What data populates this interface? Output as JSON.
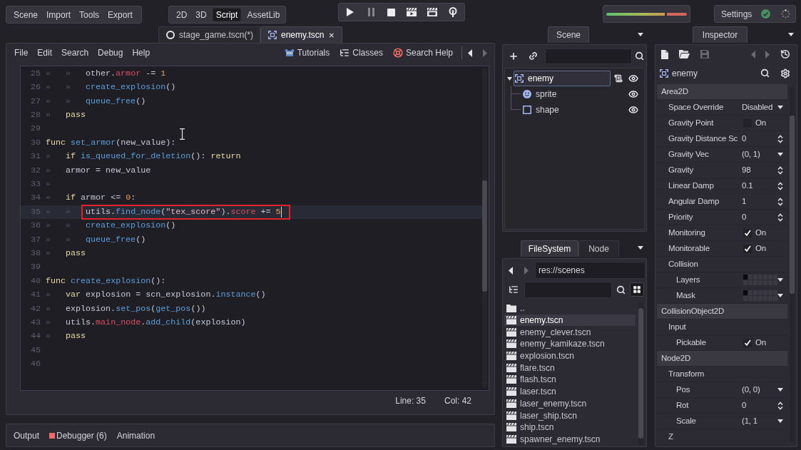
{
  "top_menu": [
    "Scene",
    "Import",
    "Tools",
    "Export"
  ],
  "main_screens": [
    {
      "label": "2D",
      "selected": false
    },
    {
      "label": "3D",
      "selected": false
    },
    {
      "label": "Script",
      "selected": true
    },
    {
      "label": "AssetLib",
      "selected": false
    }
  ],
  "play_controls": [
    {
      "kind": "play",
      "disabled": false
    },
    {
      "kind": "pause",
      "disabled": true
    },
    {
      "kind": "stop",
      "disabled": false
    },
    {
      "kind": "play_scene",
      "disabled": false
    },
    {
      "kind": "play_custom",
      "disabled": false
    },
    {
      "kind": "remote",
      "disabled": false
    }
  ],
  "audio_meter": {
    "level": 1
  },
  "settings": {
    "label": "Settings"
  },
  "scene_tabs": [
    {
      "label": "stage_game.tscn(*)",
      "kind": "node",
      "selected": false
    },
    {
      "label": "enemy.tscn",
      "kind": "area2d",
      "selected": true
    }
  ],
  "script_editor": {
    "menu": [
      "File",
      "Edit",
      "Search",
      "Debug",
      "Help"
    ],
    "help_links": [
      {
        "kind": "tutorials",
        "label": "Tutorials"
      },
      {
        "kind": "classes",
        "label": "Classes"
      },
      {
        "kind": "search_help",
        "label": "Search Help"
      }
    ],
    "nav": [
      {
        "kind": "back",
        "disabled": false
      },
      {
        "kind": "forward",
        "disabled": true
      }
    ],
    "lines": [
      {
        "number": "25",
        "indent": [
          "»",
          "»"
        ],
        "tokens": [
          {
            "kind": "plain",
            "text": "other."
          },
          {
            "kind": "member",
            "text": "armor"
          },
          {
            "kind": "plain",
            "text": " -= "
          },
          {
            "kind": "number",
            "text": "1"
          }
        ],
        "current": false,
        "boxed": false
      },
      {
        "number": "26",
        "indent": [
          "»",
          "»"
        ],
        "tokens": [
          {
            "kind": "function",
            "text": "create_explosion"
          },
          {
            "kind": "plain",
            "text": "()"
          }
        ],
        "current": false,
        "boxed": false
      },
      {
        "number": "27",
        "indent": [
          "»",
          "»"
        ],
        "tokens": [
          {
            "kind": "function",
            "text": "queue_free"
          },
          {
            "kind": "plain",
            "text": "()"
          }
        ],
        "current": false,
        "boxed": false
      },
      {
        "number": "28",
        "indent": [
          "»"
        ],
        "tokens": [
          {
            "kind": "keyword",
            "text": "pass"
          }
        ],
        "current": false,
        "boxed": false
      },
      {
        "number": "29",
        "current": false,
        "boxed": false
      },
      {
        "number": "30",
        "tokens": [
          {
            "kind": "keyword",
            "text": "func"
          },
          {
            "kind": "function",
            "text": " set_armor"
          },
          {
            "kind": "plain",
            "text": "(new_value):"
          }
        ],
        "current": false,
        "boxed": false
      },
      {
        "number": "31",
        "indent": [
          "»"
        ],
        "tokens": [
          {
            "kind": "keyword",
            "text": "if"
          },
          {
            "kind": "function",
            "text": " is_queued_for_deletion"
          },
          {
            "kind": "plain",
            "text": "(): "
          },
          {
            "kind": "keyword",
            "text": "return"
          }
        ],
        "current": false,
        "boxed": false
      },
      {
        "number": "32",
        "indent": [
          "»"
        ],
        "tokens": [
          {
            "kind": "plain",
            "text": "armor = new_value"
          }
        ],
        "current": false,
        "boxed": false
      },
      {
        "number": "33",
        "indent": [
          "»"
        ],
        "current": false,
        "boxed": false
      },
      {
        "number": "34",
        "indent": [
          "»"
        ],
        "tokens": [
          {
            "kind": "keyword",
            "text": "if"
          },
          {
            "kind": "plain",
            "text": " armor <= "
          },
          {
            "kind": "number",
            "text": "0"
          },
          {
            "kind": "plain",
            "text": ":"
          }
        ],
        "current": false,
        "boxed": false
      },
      {
        "number": "35",
        "indent": [
          "»",
          "»"
        ],
        "tokens": [
          {
            "kind": "plain",
            "text": "utils."
          },
          {
            "kind": "function",
            "text": "find_node"
          },
          {
            "kind": "plain",
            "text": "("
          },
          {
            "kind": "string",
            "text": "\"tex_score\""
          },
          {
            "kind": "plain",
            "text": ")."
          },
          {
            "kind": "member",
            "text": "score"
          },
          {
            "kind": "plain",
            "text": " += "
          },
          {
            "kind": "number",
            "text": "5"
          }
        ],
        "current": true,
        "boxed": true
      },
      {
        "number": "36",
        "indent": [
          "»",
          "»"
        ],
        "tokens": [
          {
            "kind": "function",
            "text": "create_explosion"
          },
          {
            "kind": "plain",
            "text": "()"
          }
        ],
        "current": false,
        "boxed": false
      },
      {
        "number": "37",
        "indent": [
          "»",
          "»"
        ],
        "tokens": [
          {
            "kind": "function",
            "text": "queue_free"
          },
          {
            "kind": "plain",
            "text": "()"
          }
        ],
        "current": false,
        "boxed": false
      },
      {
        "number": "38",
        "indent": [
          "»"
        ],
        "tokens": [
          {
            "kind": "keyword",
            "text": "pass"
          }
        ],
        "current": false,
        "boxed": false
      },
      {
        "number": "39",
        "current": false,
        "boxed": false
      },
      {
        "number": "40",
        "tokens": [
          {
            "kind": "keyword",
            "text": "func"
          },
          {
            "kind": "function",
            "text": " create_explosion"
          },
          {
            "kind": "plain",
            "text": "():"
          }
        ],
        "current": false,
        "boxed": false
      },
      {
        "number": "41",
        "indent": [
          "»"
        ],
        "tokens": [
          {
            "kind": "keyword",
            "text": "var"
          },
          {
            "kind": "plain",
            "text": " explosion = scn_explosion."
          },
          {
            "kind": "function",
            "text": "instance"
          },
          {
            "kind": "plain",
            "text": "()"
          }
        ],
        "current": false,
        "boxed": false
      },
      {
        "number": "42",
        "indent": [
          "»"
        ],
        "tokens": [
          {
            "kind": "plain",
            "text": "explosion."
          },
          {
            "kind": "function",
            "text": "set_pos"
          },
          {
            "kind": "plain",
            "text": "("
          },
          {
            "kind": "function",
            "text": "get_pos"
          },
          {
            "kind": "plain",
            "text": "())"
          }
        ],
        "current": false,
        "boxed": false
      },
      {
        "number": "43",
        "indent": [
          "»"
        ],
        "tokens": [
          {
            "kind": "plain",
            "text": "utils."
          },
          {
            "kind": "member",
            "text": "main_node"
          },
          {
            "kind": "plain",
            "text": "."
          },
          {
            "kind": "function",
            "text": "add_child"
          },
          {
            "kind": "plain",
            "text": "(explosion)"
          }
        ],
        "current": false,
        "boxed": false
      },
      {
        "number": "44",
        "indent": [
          "»"
        ],
        "tokens": [
          {
            "kind": "keyword",
            "text": "pass"
          }
        ],
        "current": false,
        "boxed": false
      },
      {
        "number": "45",
        "current": false,
        "boxed": false
      },
      {
        "number": "46",
        "current": false,
        "boxed": false
      }
    ],
    "status": {
      "line": "Line: 35",
      "column": "Col: 42"
    }
  },
  "bottom_tabs": [
    {
      "label": "Output",
      "alert": false
    },
    {
      "label": "Debugger (6)",
      "alert": true
    },
    {
      "label": "Animation",
      "alert": false
    }
  ],
  "scene_dock": {
    "tab": "Scene",
    "tree": [
      {
        "name": "enemy",
        "kind": "area2d",
        "selected": true,
        "expanded": true,
        "has_script": true,
        "visible": true,
        "children": [
          {
            "name": "sprite",
            "kind": "sprite",
            "selected": false,
            "has_script": false,
            "visible": true
          },
          {
            "name": "shape",
            "kind": "shape",
            "selected": false,
            "has_script": false,
            "visible": true
          }
        ]
      }
    ]
  },
  "filesystem_dock": {
    "tabs": [
      {
        "label": "FileSystem",
        "selected": true
      },
      {
        "label": "Node",
        "selected": false
      }
    ],
    "nav": [
      {
        "kind": "back",
        "disabled": false
      },
      {
        "kind": "forward",
        "disabled": true
      }
    ],
    "path": "res://scenes",
    "files": [
      {
        "name": "..",
        "kind": "folder",
        "selected": false
      },
      {
        "name": "enemy.tscn",
        "kind": "scene",
        "selected": true
      },
      {
        "name": "enemy_clever.tscn",
        "kind": "scene",
        "selected": false
      },
      {
        "name": "enemy_kamikaze.tscn",
        "kind": "scene",
        "selected": false
      },
      {
        "name": "explosion.tscn",
        "kind": "scene",
        "selected": false
      },
      {
        "name": "flare.tscn",
        "kind": "scene",
        "selected": false
      },
      {
        "name": "flash.tscn",
        "kind": "scene",
        "selected": false
      },
      {
        "name": "laser.tscn",
        "kind": "scene",
        "selected": false
      },
      {
        "name": "laser_enemy.tscn",
        "kind": "scene",
        "selected": false
      },
      {
        "name": "laser_ship.tscn",
        "kind": "scene",
        "selected": false
      },
      {
        "name": "ship.tscn",
        "kind": "scene",
        "selected": false
      },
      {
        "name": "spawner_enemy.tscn",
        "kind": "scene",
        "selected": false
      }
    ]
  },
  "inspector": {
    "tab": "Inspector",
    "toolbar": [
      {
        "kind": "new",
        "disabled": false
      },
      {
        "kind": "open",
        "disabled": false
      },
      {
        "kind": "save",
        "disabled": true
      },
      {
        "kind": "back",
        "disabled": true
      },
      {
        "kind": "forward",
        "disabled": true
      },
      {
        "kind": "history",
        "disabled": false
      }
    ],
    "node": {
      "name": "enemy",
      "kind": "area2d"
    },
    "sections": [
      {
        "title": "Area2D",
        "properties": [
          {
            "kind": "enum",
            "label": "Space Override",
            "value": "Disabled"
          },
          {
            "kind": "bool",
            "label": "Gravity Point",
            "value": "On",
            "checked": false
          },
          {
            "kind": "number",
            "label": "Gravity Distance Sc",
            "value": "0"
          },
          {
            "kind": "enum",
            "label": "Gravity Vec",
            "value": "(0, 1)"
          },
          {
            "kind": "number",
            "label": "Gravity",
            "value": "98"
          },
          {
            "kind": "number",
            "label": "Linear Damp",
            "value": "0.1"
          },
          {
            "kind": "number",
            "label": "Angular Damp",
            "value": "1"
          },
          {
            "kind": "number",
            "label": "Priority",
            "value": "0"
          },
          {
            "kind": "bool",
            "label": "Monitoring",
            "value": "On",
            "checked": true
          },
          {
            "kind": "bool",
            "label": "Monitorable",
            "value": "On",
            "checked": true
          },
          {
            "kind": "group",
            "label": "Collision",
            "children": [
              {
                "kind": "layers",
                "label": "Layers",
                "bits": [
                  {
                    "on": true
                  },
                  {
                    "on": false
                  },
                  {
                    "on": false
                  },
                  {
                    "on": false
                  },
                  {
                    "on": false
                  },
                  {
                    "on": false
                  },
                  {
                    "on": false
                  },
                  {
                    "on": false
                  },
                  {
                    "on": false
                  },
                  {
                    "on": false
                  },
                  {
                    "on": false
                  },
                  {
                    "on": false
                  },
                  {
                    "on": false
                  },
                  {
                    "on": false
                  }
                ]
              },
              {
                "kind": "layers",
                "label": "Mask",
                "bits": [
                  {
                    "on": true
                  },
                  {
                    "on": false
                  },
                  {
                    "on": false
                  },
                  {
                    "on": false
                  },
                  {
                    "on": false
                  },
                  {
                    "on": false
                  },
                  {
                    "on": false
                  },
                  {
                    "on": false
                  },
                  {
                    "on": false
                  },
                  {
                    "on": false
                  },
                  {
                    "on": false
                  },
                  {
                    "on": false
                  },
                  {
                    "on": false
                  },
                  {
                    "on": false
                  }
                ]
              }
            ]
          }
        ]
      },
      {
        "title": "CollisionObject2D",
        "properties": [
          {
            "kind": "group",
            "label": "Input",
            "children": [
              {
                "kind": "bool",
                "label": "Pickable",
                "value": "On",
                "checked": true
              }
            ]
          }
        ]
      },
      {
        "title": "Node2D",
        "properties": [
          {
            "kind": "group",
            "label": "Transform",
            "children": [
              {
                "kind": "enum",
                "label": "Pos",
                "value": "(0, 0)"
              },
              {
                "kind": "number",
                "label": "Rot",
                "value": "0"
              },
              {
                "kind": "enum",
                "label": "Scale",
                "value": "(1, 1"
              }
            ]
          },
          {
            "kind": "group",
            "label": "Z"
          }
        ]
      }
    ]
  }
}
